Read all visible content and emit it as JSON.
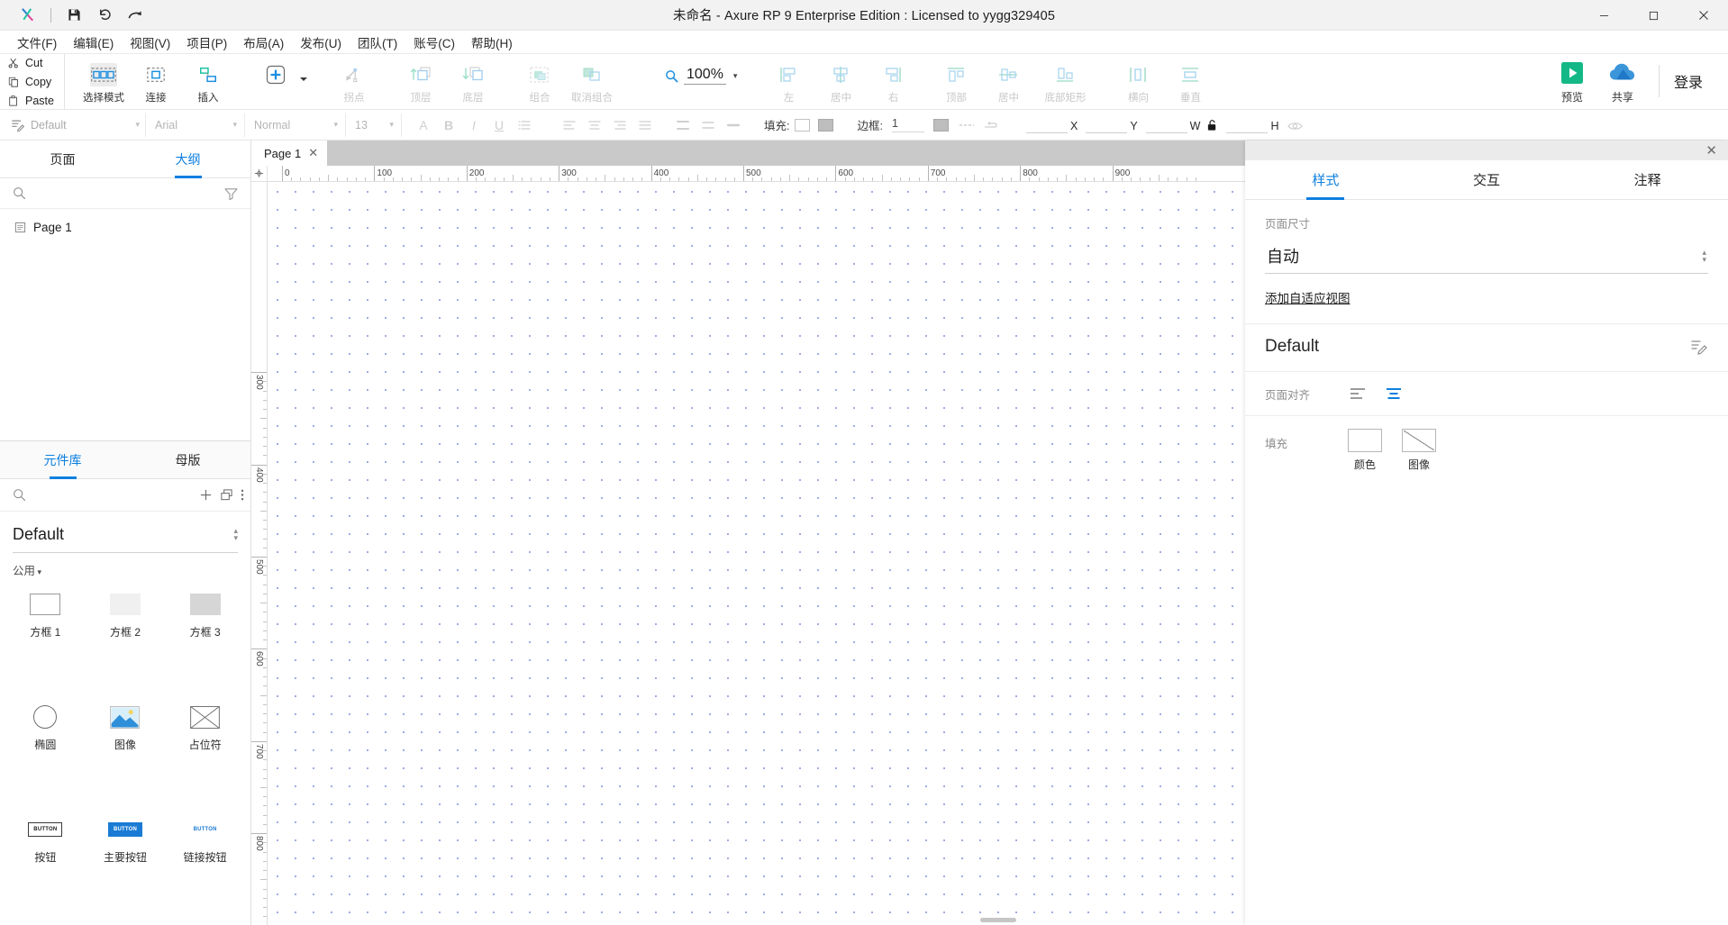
{
  "window": {
    "title": "未命名 - Axure RP 9 Enterprise Edition : Licensed to yygg329405",
    "minimize": "─",
    "maximize": "☐",
    "close": "✕"
  },
  "quick_access": {
    "save": "save-icon",
    "undo": "undo-icon",
    "redo": "redo-icon"
  },
  "menu": {
    "items": [
      {
        "label": "文件(F)"
      },
      {
        "label": "编辑(E)"
      },
      {
        "label": "视图(V)"
      },
      {
        "label": "项目(P)"
      },
      {
        "label": "布局(A)"
      },
      {
        "label": "发布(U)"
      },
      {
        "label": "团队(T)"
      },
      {
        "label": "账号(C)"
      },
      {
        "label": "帮助(H)"
      }
    ]
  },
  "toolbar": {
    "clipboard": {
      "cut": "Cut",
      "copy": "Copy",
      "paste": "Paste"
    },
    "tools": [
      {
        "label": "选择模式",
        "icon": "select-mode-icon",
        "active": true,
        "disabled": false
      },
      {
        "label": "连接",
        "icon": "connect-icon",
        "active": false,
        "disabled": false
      },
      {
        "label": "插入",
        "icon": "insert-icon",
        "active": false,
        "disabled": false
      }
    ],
    "arrange": [
      {
        "label": "拐点",
        "icon": "bend-point-icon",
        "disabled": true
      },
      {
        "label": "顶层",
        "icon": "bring-to-front-icon",
        "disabled": true
      },
      {
        "label": "底层",
        "icon": "send-to-back-icon",
        "disabled": true
      },
      {
        "label": "组合",
        "icon": "group-icon",
        "disabled": true
      },
      {
        "label": "取消组合",
        "icon": "ungroup-icon",
        "disabled": true
      }
    ],
    "zoom": {
      "value": "100%",
      "icon": "magnifier-icon"
    },
    "align": [
      {
        "label": "左",
        "icon": "align-left-icon",
        "disabled": true
      },
      {
        "label": "居中",
        "icon": "align-center-icon",
        "disabled": true
      },
      {
        "label": "右",
        "icon": "align-right-icon",
        "disabled": true
      },
      {
        "label": "顶部",
        "icon": "align-top-icon",
        "disabled": true
      },
      {
        "label": "居中",
        "icon": "align-middle-icon",
        "disabled": true
      },
      {
        "label": "底部矩形",
        "icon": "align-bottom-icon",
        "disabled": true
      }
    ],
    "distribute": [
      {
        "label": "横向",
        "icon": "distribute-horizontal-icon",
        "disabled": true
      },
      {
        "label": "垂直",
        "icon": "distribute-vertical-icon",
        "disabled": true
      }
    ],
    "preview": {
      "label": "预览",
      "icon": "play-icon"
    },
    "share": {
      "label": "共享",
      "icon": "cloud-icon"
    },
    "login": "登录"
  },
  "formatbar": {
    "style_name": "Default",
    "font_family": "Arial",
    "font_weight": "Normal",
    "font_size": "13",
    "fill_label": "填充:",
    "border_label": "边框:",
    "border_width": "1",
    "coords": {
      "x_label": "X",
      "y_label": "Y",
      "w_label": "W",
      "h_label": "H",
      "x_value": "",
      "y_value": "",
      "w_value": "",
      "h_value": ""
    },
    "icons": [
      "text-color-icon",
      "bold-icon",
      "italic-icon",
      "underline-icon",
      "list-icon",
      "align-left-icon",
      "align-center-icon",
      "align-right-icon",
      "align-justify-icon",
      "line-spacing-icon",
      "padding-icon",
      "bullet-icon",
      "lock-icon",
      "visibility-icon"
    ]
  },
  "left_panel": {
    "tabs": [
      {
        "label": "页面",
        "active": false
      },
      {
        "label": "大纲",
        "active": true
      }
    ],
    "search_placeholder": "",
    "filter_icon": "filter-icon",
    "pages": [
      {
        "label": "Page 1",
        "icon": "page-icon"
      }
    ]
  },
  "library_panel": {
    "tabs": [
      {
        "label": "元件库",
        "active": true
      },
      {
        "label": "母版",
        "active": false
      }
    ],
    "search_placeholder": "",
    "actions": [
      "add-library-icon",
      "duplicate-icon",
      "more-options-icon"
    ],
    "selected_library": "Default",
    "category": "公用",
    "widgets": [
      {
        "label": "方框 1",
        "shape": "box1"
      },
      {
        "label": "方框 2",
        "shape": "box2"
      },
      {
        "label": "方框 3",
        "shape": "box3"
      },
      {
        "label": "椭圆",
        "shape": "circle"
      },
      {
        "label": "图像",
        "shape": "image"
      },
      {
        "label": "占位符",
        "shape": "placeholder"
      },
      {
        "label": "按钮",
        "shape": "button",
        "button_text": "BUTTON"
      },
      {
        "label": "主要按钮",
        "shape": "button-primary",
        "button_text": "BUTTON"
      },
      {
        "label": "链接按钮",
        "shape": "button-link",
        "button_text": "BUTTON"
      }
    ]
  },
  "canvas": {
    "tab": {
      "label": "Page 1",
      "close": "✕"
    },
    "h_ticks": [
      "0",
      "100",
      "200",
      "300",
      "400",
      "500",
      "600",
      "700",
      "800",
      "900"
    ],
    "v_ticks": [
      "300",
      "400",
      "500",
      "600",
      "700",
      "800"
    ],
    "zoom_level": "100%"
  },
  "right_panel": {
    "close": "✕",
    "tabs": [
      {
        "label": "样式",
        "active": true
      },
      {
        "label": "交互",
        "active": false
      },
      {
        "label": "注释",
        "active": false
      }
    ],
    "page_size": {
      "label": "页面尺寸",
      "value": "自动"
    },
    "adaptive_link": "添加自适应视图",
    "style_name": "Default",
    "style_edit_icon": "edit-style-icon",
    "page_align": {
      "label": "页面对齐",
      "options": [
        {
          "icon": "align-page-left-icon",
          "active": false
        },
        {
          "icon": "align-page-center-icon",
          "active": true
        }
      ]
    },
    "fill": {
      "label": "填充",
      "options": [
        {
          "label": "颜色",
          "icon": "fill-color-icon"
        },
        {
          "label": "图像",
          "icon": "fill-image-icon"
        }
      ]
    }
  },
  "colors": {
    "accent": "#0d7fe0",
    "preview_green": "#13b886",
    "share_blue": "#2f8fd8",
    "dot_grid": "#6a7bd8",
    "tab_strip": "#c9c9c9"
  }
}
